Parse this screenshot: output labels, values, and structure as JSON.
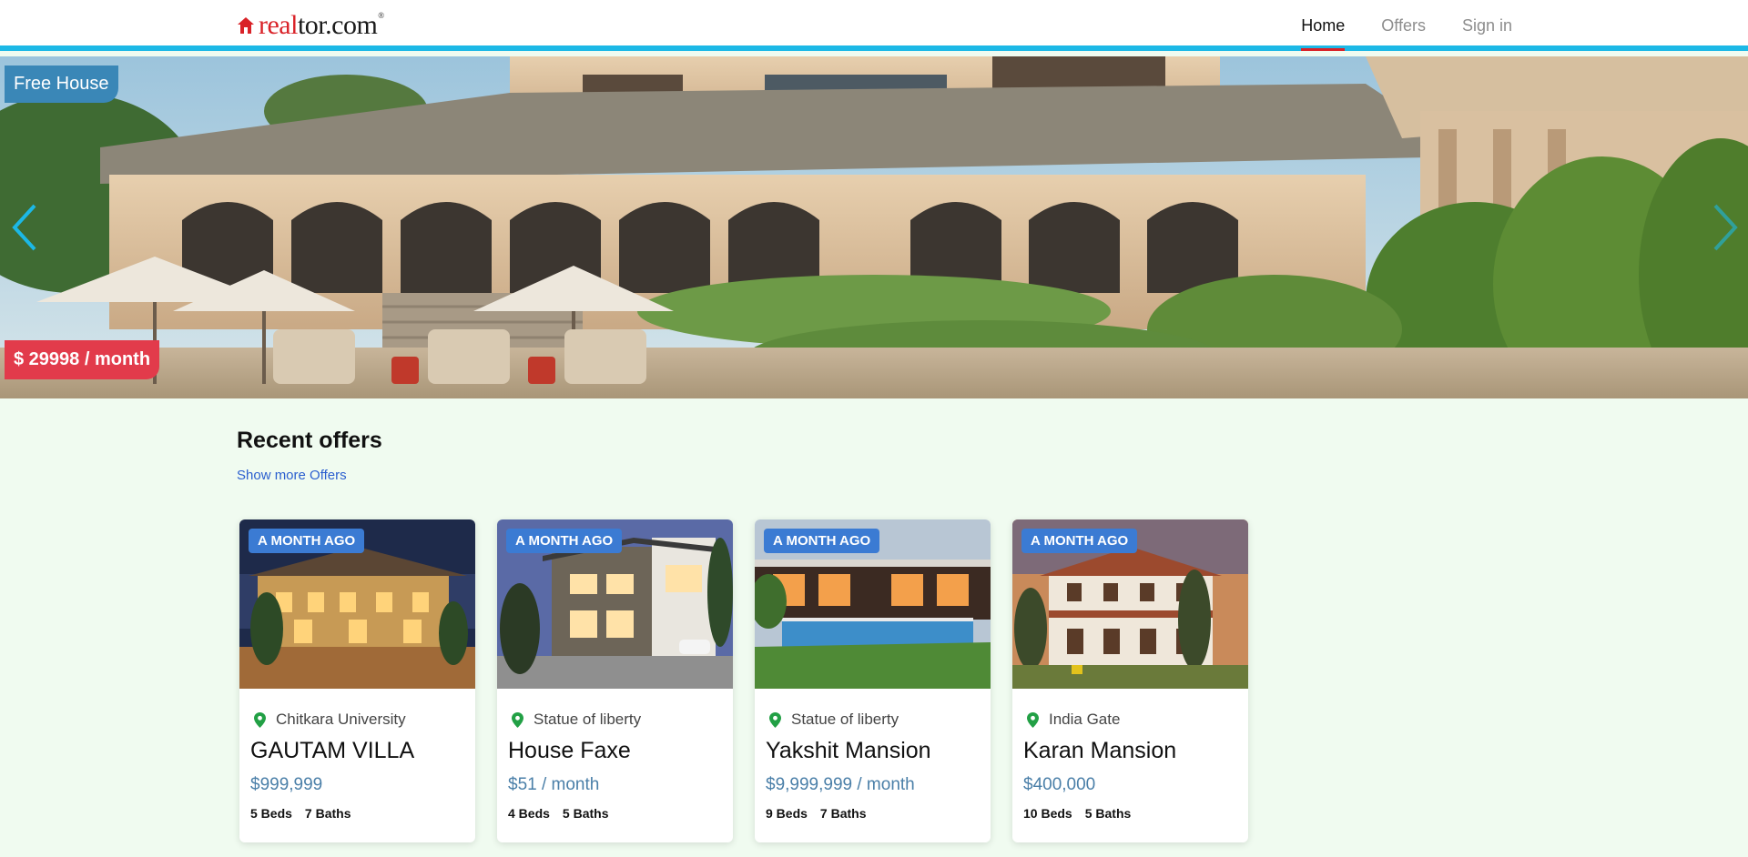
{
  "header": {
    "logo": {
      "red": "real",
      "black": "tor.com",
      "tm": "®"
    },
    "nav": [
      {
        "label": "Home",
        "active": true
      },
      {
        "label": "Offers",
        "active": false
      },
      {
        "label": "Sign in",
        "active": false
      }
    ],
    "accent_color": "#1cb8e6"
  },
  "hero": {
    "tag": "Free House",
    "price": "$ 29998 / month"
  },
  "offers": {
    "title": "Recent offers",
    "show_more": "Show more Offers",
    "cards": [
      {
        "badge": "A MONTH AGO",
        "location": "Chitkara University",
        "title": "GAUTAM VILLA",
        "price": "$999,999",
        "beds": "5 Beds",
        "baths": "7 Baths"
      },
      {
        "badge": "A MONTH AGO",
        "location": "Statue of liberty",
        "title": "House Faxe",
        "price": "$51 / month",
        "beds": "4 Beds",
        "baths": "5 Baths"
      },
      {
        "badge": "A MONTH AGO",
        "location": "Statue of liberty",
        "title": "Yakshit Mansion",
        "price": "$9,999,999 / month",
        "beds": "9 Beds",
        "baths": "7 Baths"
      },
      {
        "badge": "A MONTH AGO",
        "location": "India Gate",
        "title": "Karan Mansion",
        "price": "$400,000",
        "beds": "10 Beds",
        "baths": "5 Baths"
      }
    ]
  },
  "colors": {
    "brand_red": "#d92228",
    "badge_blue": "#3b7bd3",
    "price_red": "#e23b4b",
    "pin_green": "#22a045"
  }
}
